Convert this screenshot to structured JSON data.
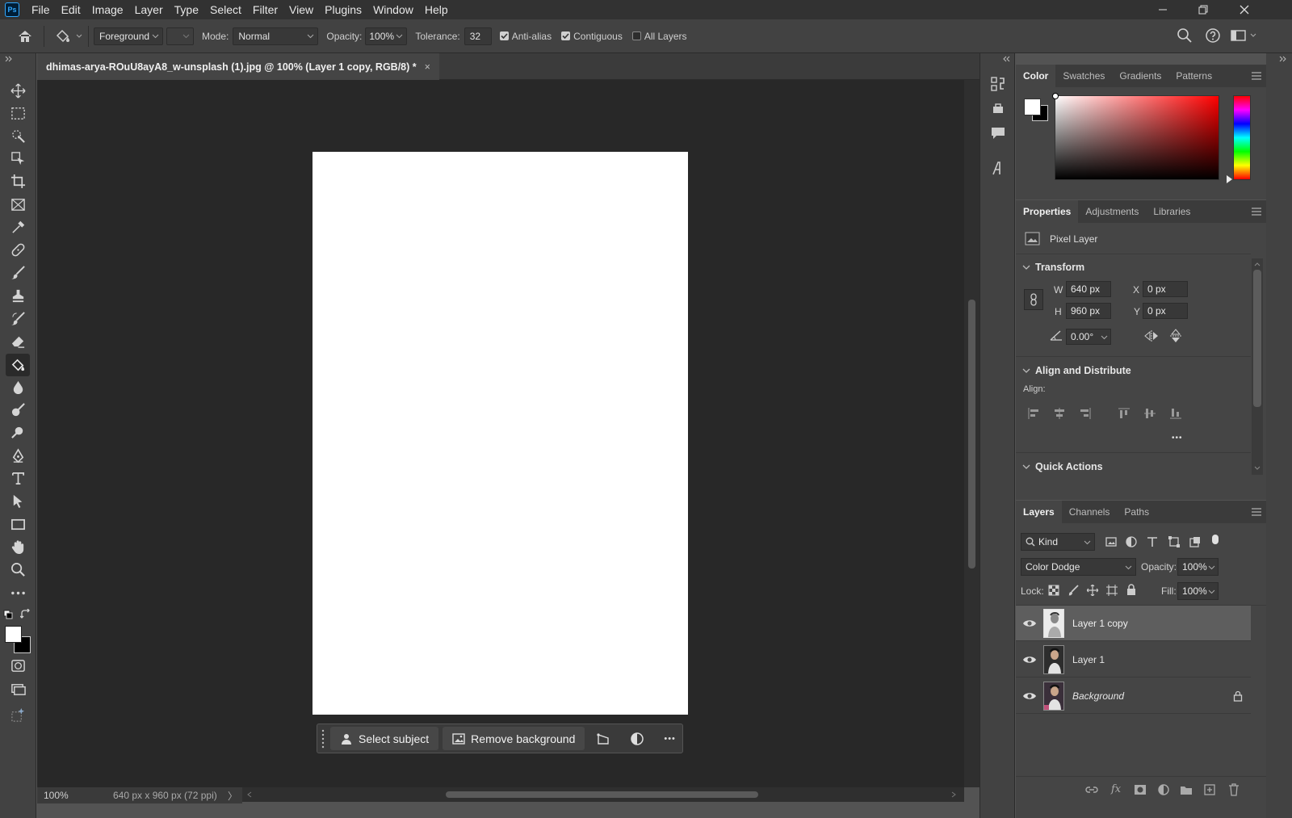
{
  "app": {
    "logo": "Ps"
  },
  "menu": [
    "File",
    "Edit",
    "Image",
    "Layer",
    "Type",
    "Select",
    "Filter",
    "View",
    "Plugins",
    "Window",
    "Help"
  ],
  "options": {
    "fill_source": "Foreground",
    "mode_label": "Mode:",
    "mode_value": "Normal",
    "opacity_label": "Opacity:",
    "opacity_value": "100%",
    "tolerance_label": "Tolerance:",
    "tolerance_value": "32",
    "anti_alias": {
      "label": "Anti-alias",
      "checked": true
    },
    "contiguous": {
      "label": "Contiguous",
      "checked": true
    },
    "all_layers": {
      "label": "All Layers",
      "checked": false
    }
  },
  "document": {
    "tab_title": "dhimas-arya-ROuU8ayA8_w-unsplash (1).jpg @ 100% (Layer 1 copy, RGB/8) *",
    "close": "×"
  },
  "status": {
    "zoom": "100%",
    "info": "640 px x 960 px (72 ppi)",
    "arrow": "〉"
  },
  "context_bar": {
    "select_subject": "Select subject",
    "remove_background": "Remove background",
    "more": "•••"
  },
  "color_panel": {
    "tabs": [
      "Color",
      "Swatches",
      "Gradients",
      "Patterns"
    ],
    "foreground": "#ffffff",
    "background": "#000000",
    "hue": "#ff0000"
  },
  "properties_panel": {
    "tabs": [
      "Properties",
      "Adjustments",
      "Libraries"
    ],
    "layer_type": "Pixel Layer",
    "transform": {
      "title": "Transform",
      "w_label": "W",
      "w": "640 px",
      "h_label": "H",
      "h": "960 px",
      "x_label": "X",
      "x": "0 px",
      "y_label": "Y",
      "y": "0 px",
      "angle": "0.00°"
    },
    "align": {
      "title": "Align and Distribute",
      "label": "Align:",
      "more": "•••"
    },
    "quick_actions": {
      "title": "Quick Actions"
    }
  },
  "layers_panel": {
    "tabs": [
      "Layers",
      "Channels",
      "Paths"
    ],
    "filter_kind": "Kind",
    "blend_mode": "Color Dodge",
    "opacity_label": "Opacity:",
    "opacity": "100%",
    "lock_label": "Lock:",
    "fill_label": "Fill:",
    "fill": "100%",
    "layers": [
      {
        "name": "Layer 1 copy",
        "selected": true,
        "italic": false,
        "locked": false
      },
      {
        "name": "Layer 1",
        "selected": false,
        "italic": false,
        "locked": false
      },
      {
        "name": "Background",
        "selected": false,
        "italic": true,
        "locked": true
      }
    ]
  }
}
